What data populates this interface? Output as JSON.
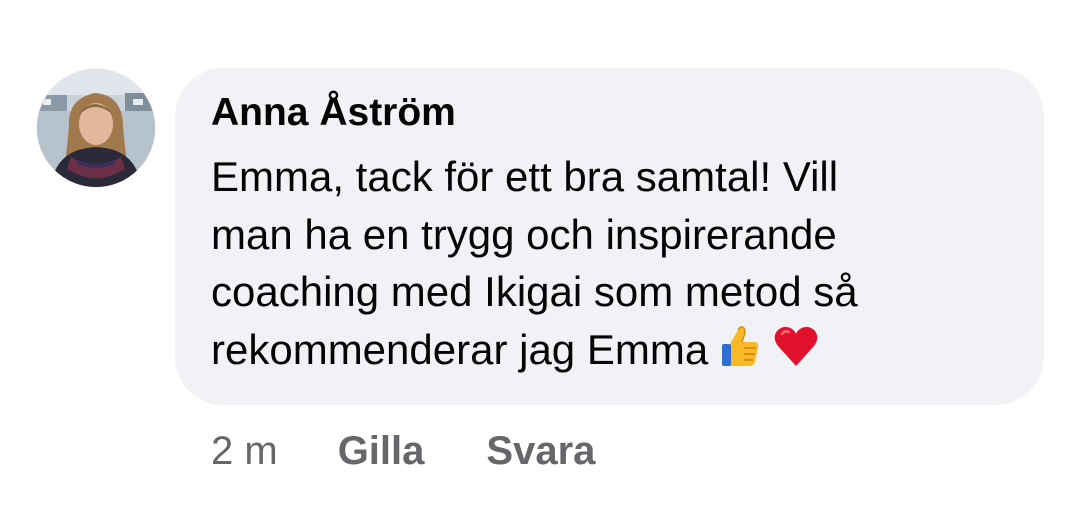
{
  "comment": {
    "author": "Anna Åström",
    "text_lines": [
      "Emma, tack för ett bra samtal! Vill",
      "man ha en trygg och inspirerande",
      "coaching med Ikigai som metod så",
      "rekommenderar jag Emma"
    ],
    "emojis": [
      "thumbs-up-icon",
      "red-heart-icon"
    ],
    "timestamp": "2 m",
    "actions": {
      "like_label": "Gilla",
      "reply_label": "Svara"
    }
  },
  "colors": {
    "bubble_background": "#f0f2f5",
    "text": "#050505",
    "secondary_text": "#65676b"
  }
}
